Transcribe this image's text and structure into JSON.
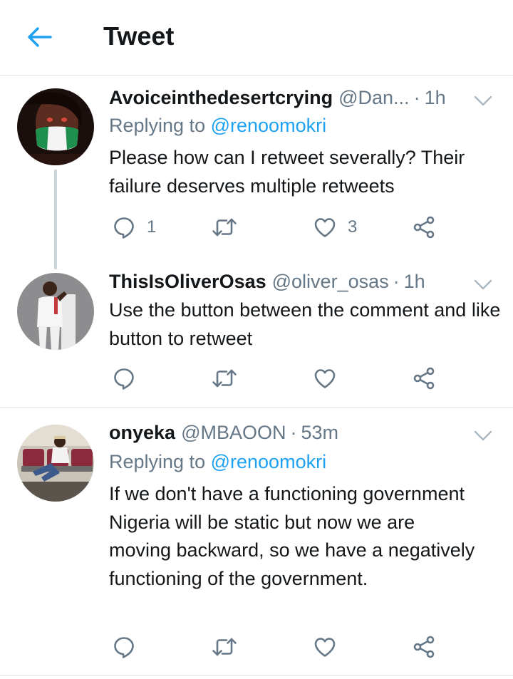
{
  "header": {
    "title": "Tweet",
    "back_icon": "arrow-left-icon"
  },
  "colors": {
    "accent": "#1da1f2",
    "secondary": "#657786",
    "divider": "#e1e8ed",
    "text": "#14171a"
  },
  "tweets": [
    {
      "name": "Avoiceinthedesertcrying",
      "handle": "@Dan...",
      "sep": "·",
      "time": "1h",
      "replying_prefix": "Replying to",
      "replying_to": "@renoomokri",
      "text": "Please how can I retweet severally? Their failure deserves multiple retweets",
      "reply_count": "1",
      "retweet_count": "",
      "like_count": "3"
    },
    {
      "name": "ThisIsOliverOsas",
      "handle": "@oliver_osas",
      "sep": "·",
      "time": "1h",
      "text": "Use the button between the comment and like button to retweet",
      "reply_count": "",
      "retweet_count": "",
      "like_count": ""
    },
    {
      "name": "onyeka",
      "handle": "@MBAOON",
      "sep": "·",
      "time": "53m",
      "replying_prefix": "Replying to",
      "replying_to": "@renoomokri",
      "text": "If we don't have a functioning government Nigeria will be static but now we are moving backward, so we have a negatively functioning of the government.",
      "reply_count": "",
      "retweet_count": "",
      "like_count": ""
    }
  ]
}
